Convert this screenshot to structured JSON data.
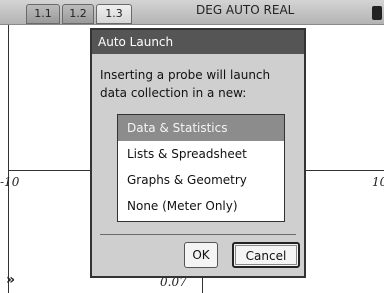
{
  "tabs": [
    {
      "label": "1.1"
    },
    {
      "label": "1.2"
    },
    {
      "label": "1.3"
    }
  ],
  "status_text": "DEG AUTO REAL",
  "graph": {
    "x_min_label": "-10",
    "x_max_label": "10",
    "y_label": "0.07"
  },
  "dialog": {
    "title": "Auto Launch",
    "message": "Inserting a probe will launch data collection in a new:",
    "options": [
      {
        "label": "Data & Statistics",
        "selected": true
      },
      {
        "label": "Lists & Spreadsheet",
        "selected": false
      },
      {
        "label": "Graphs & Geometry",
        "selected": false
      },
      {
        "label": "None (Meter Only)",
        "selected": false
      }
    ],
    "ok_label": "OK",
    "cancel_label": "Cancel"
  },
  "icons": {
    "expand": "»",
    "cursor": "mouse-pointer-icon"
  }
}
